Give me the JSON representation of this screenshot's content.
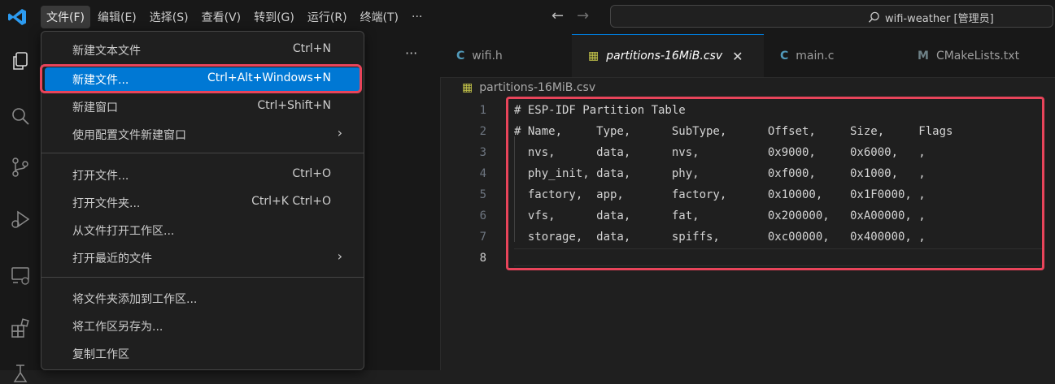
{
  "menu_bar": [
    "文件(F)",
    "编辑(E)",
    "选择(S)",
    "查看(V)",
    "转到(G)",
    "运行(R)",
    "终端(T)",
    "···"
  ],
  "nav": {
    "back": "←",
    "forward": "→"
  },
  "search": {
    "icon": "search-icon",
    "text": "wifi-weather [管理员]"
  },
  "sidebar": {
    "more": "···"
  },
  "file_menu": {
    "items": [
      {
        "label": "新建文本文件",
        "shortcut": "Ctrl+N"
      },
      {
        "label": "新建文件...",
        "shortcut": "Ctrl+Alt+Windows+N",
        "highlighted": true
      },
      {
        "label": "新建窗口",
        "shortcut": "Ctrl+Shift+N"
      },
      {
        "label": "使用配置文件新建窗口",
        "submenu": "›"
      },
      {
        "label": "打开文件...",
        "shortcut": "Ctrl+O"
      },
      {
        "label": "打开文件夹...",
        "shortcut": "Ctrl+K Ctrl+O"
      },
      {
        "label": "从文件打开工作区..."
      },
      {
        "label": "打开最近的文件",
        "submenu": "›"
      },
      {
        "label": "将文件夹添加到工作区..."
      },
      {
        "label": "将工作区另存为..."
      },
      {
        "label": "复制工作区"
      }
    ]
  },
  "tabs": [
    {
      "icon": "C",
      "label": "wifi.h",
      "icon_color": "#519aba"
    },
    {
      "icon": "▦",
      "label": "partitions-16MiB.csv",
      "close": "✕",
      "active": true,
      "icon_color": "#c5c54a"
    },
    {
      "icon": "C",
      "label": "main.c",
      "icon_color": "#519aba"
    },
    {
      "icon": "M",
      "label": "CMakeLists.txt",
      "icon_color": "#6d8086"
    }
  ],
  "breadcrumb": {
    "icon": "▦",
    "file": "partitions-16MiB.csv"
  },
  "editor": {
    "lines": [
      {
        "n": "1",
        "text": "# ESP-IDF Partition Table"
      },
      {
        "n": "2",
        "text": "# Name,     Type,      SubType,      Offset,     Size,     Flags"
      },
      {
        "n": "3",
        "text": "  nvs,      data,      nvs,          0x9000,     0x6000,   ,"
      },
      {
        "n": "4",
        "text": "  phy_init, data,      phy,          0xf000,     0x1000,   ,"
      },
      {
        "n": "5",
        "text": "  factory,  app,       factory,      0x10000,    0x1F0000, ,"
      },
      {
        "n": "6",
        "text": "  vfs,      data,      fat,          0x200000,   0xA00000, ,"
      },
      {
        "n": "7",
        "text": "  storage,  data,      spiffs,       0xc00000,   0x400000, ,"
      },
      {
        "n": "8",
        "text": ""
      }
    ]
  },
  "colors": {
    "accent": "#0078d4",
    "annotation": "#e8445a"
  }
}
